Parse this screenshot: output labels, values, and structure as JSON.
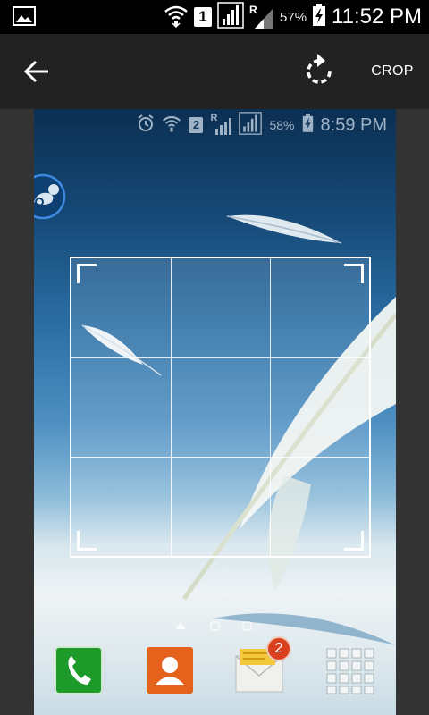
{
  "statusbar": {
    "sim": "1",
    "roaming": "R",
    "battery": "57%",
    "time": "11:52 PM"
  },
  "actionbar": {
    "crop_label": "CROP"
  },
  "photo": {
    "statusbar": {
      "sim": "2",
      "roaming": "R",
      "battery": "58%",
      "time": "8:59 PM"
    },
    "dock": {
      "message_badge": "2"
    }
  }
}
